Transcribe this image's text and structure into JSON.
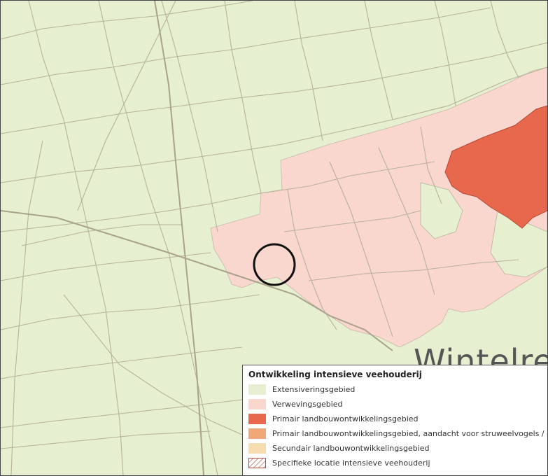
{
  "map": {
    "place_label": "Wintelre",
    "colors": {
      "extensivering": "#e6efcf",
      "verweving": "#f9d6ce",
      "primair": "#e8684d",
      "primair_aandacht": "#f0a876",
      "secundair": "#f5ddb0",
      "parcel_line": "#b7b39a",
      "road": "#a9a28c",
      "marker": "#111111"
    },
    "marker": "circle-marker-specific-location"
  },
  "legend": {
    "title": "Ontwikkeling intensieve veehouderij",
    "items": [
      {
        "label": "Extensiveringsgebied",
        "color": "#e6efcf"
      },
      {
        "label": "Verwevingsgebied",
        "color": "#f9d6ce"
      },
      {
        "label": "Primair landbouwontwikkelingsgebied",
        "color": "#e8684d"
      },
      {
        "label": "Primair landbouwontwikkelingsgebied, aandacht voor struweelvogels / dassen",
        "color": "#f0a876"
      },
      {
        "label": "Secundair landbouwontwikkelingsgebied",
        "color": "#f5ddb0"
      },
      {
        "label": "Specifieke locatie intensieve veehouderij",
        "color": "hatched"
      }
    ]
  }
}
